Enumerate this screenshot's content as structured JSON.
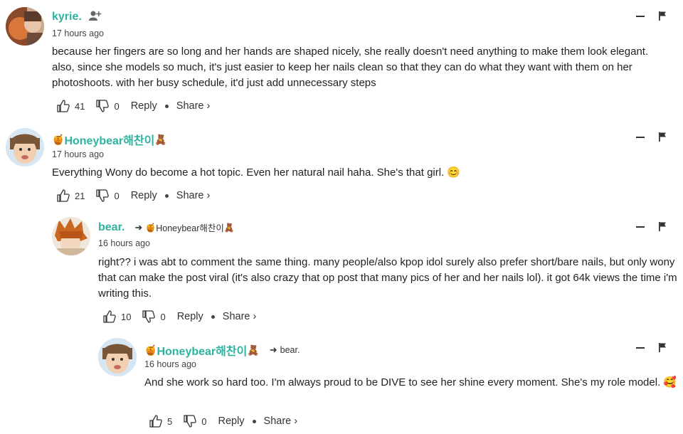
{
  "comments": [
    {
      "username": "kyrie.",
      "time": "17 hours ago",
      "text": "because her fingers are so long and her hands are shaped nicely, she really doesn't need anything to make them look elegant. also, since she models so much, it's just easier to keep her nails clean so that they can do what they want with them on her photoshoots. with her busy schedule, it'd just add unnecessary steps",
      "likes": "41",
      "dislikes": "0",
      "reply_label": "Reply",
      "share_label": "Share",
      "icons": [
        "add-friend-icon"
      ]
    },
    {
      "username": "Honeybear해찬이",
      "time": "17 hours ago",
      "text": "Everything Wony do become a hot topic. Even her natural nail haha. She's that girl. 😊",
      "likes": "21",
      "dislikes": "0",
      "reply_label": "Reply",
      "share_label": "Share",
      "icons": [
        "honey-pot-icon",
        "teddy-bear-icon"
      ]
    },
    {
      "username": "bear.",
      "reply_to": "Honeybear해찬이",
      "time": "16 hours ago",
      "text": "right?? i was abt to comment the same thing. many people/also kpop idol surely also prefer short/bare nails, but only wony that can make the post viral (it's also crazy that op post that many pics of her and her nails lol). it got 64k views the time i'm writing this.",
      "likes": "10",
      "dislikes": "0",
      "reply_label": "Reply",
      "share_label": "Share",
      "icons": [
        "reply-arrow-icon"
      ]
    },
    {
      "username": "Honeybear해찬이",
      "reply_to": "bear.",
      "time": "16 hours ago",
      "text": "And she work so hard too. I'm always proud to be DIVE to see her shine every moment. She's my role model. 🥰",
      "likes": "5",
      "dislikes": "0",
      "reply_label": "Reply",
      "share_label": "Share",
      "icons": [
        "honey-pot-icon",
        "teddy-bear-icon",
        "reply-arrow-icon"
      ]
    }
  ],
  "colors": {
    "username": "#2fb3a0",
    "text": "#222222",
    "meta": "#444444"
  }
}
